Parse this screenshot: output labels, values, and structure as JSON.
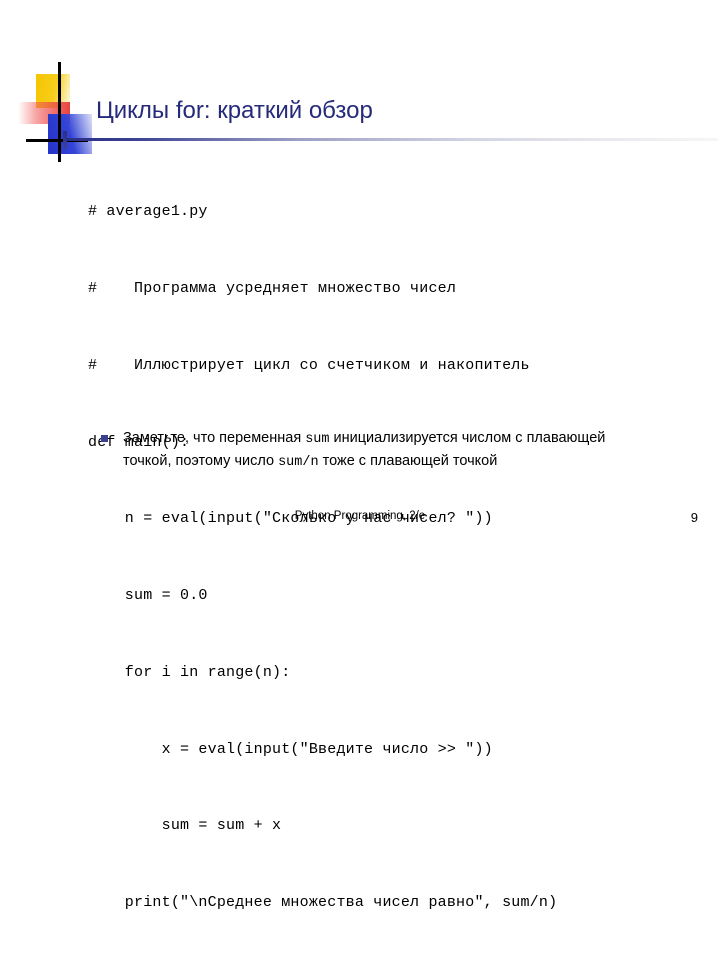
{
  "slide": {
    "title": "Циклы for: краткий обзор",
    "logo": {
      "square_yellow_color": "#f5c500",
      "square_red_color": "#e8423f",
      "square_blue_color": "#2433c8",
      "cross_color": "#000000"
    },
    "accent_color": "#252a7a",
    "code_lines": [
      "# average1.py",
      "#    Программа усредняет множество чисел",
      "#    Иллюстрирует цикл со счетчиком и накопитель",
      "def main():",
      "    n = eval(input(\"Сколько у нас чисел? \"))",
      "    sum = 0.0",
      "    for i in range(n):",
      "        x = eval(input(\"Введите число >> \"))",
      "        sum = sum + x",
      "    print(\"\\nСреднее множества чисел равно\", sum/n)"
    ],
    "bullet": {
      "text_part_1": "Заметьте, что переменная ",
      "code_1": "sum",
      "text_part_2": " инициализируется числом с плавающей точкой, поэтому число ",
      "code_2": "sum/n",
      "text_part_3": " тоже с плавающей точкой"
    },
    "footer": {
      "center": "Python Programming, 2/e",
      "page_number": "9"
    }
  }
}
